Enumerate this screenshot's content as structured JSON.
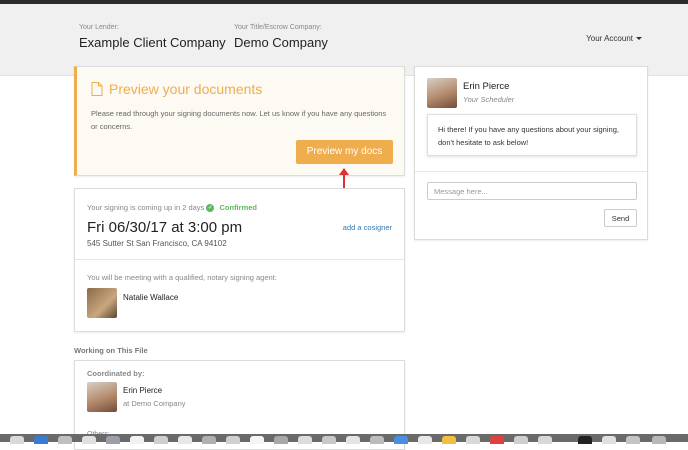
{
  "header": {
    "lender_label": "Your Lender:",
    "lender_value": "Example Client Company",
    "title_label": "Your Title/Escrow Company:",
    "title_value": "Demo Company",
    "account_label": "Your Account"
  },
  "preview": {
    "title": "Preview your documents",
    "text": "Please read through your signing documents now. Let us know if you have any questions or concerns.",
    "button_label": "Preview my docs",
    "accent_color": "#f0ad4e"
  },
  "signing": {
    "coming_text": "Your signing is coming up in 2 days",
    "status": "Confirmed",
    "date": "Fri 06/30/17 at 3:00 pm",
    "address": "545 Sutter St San Francisco, CA 94102",
    "cosigner_link": "add a cosigner",
    "meeting_text": "You will be meeting with a qualified, notary signing agent:",
    "agent_name": "Natalie Wallace"
  },
  "working": {
    "title": "Working on This File",
    "coordinated_label": "Coordinated by:",
    "coordinator_name": "Erin Pierce",
    "coordinator_company": "at Demo Company",
    "others_label": "Others:"
  },
  "scheduler": {
    "name": "Erin Pierce",
    "role": "Your Scheduler",
    "message": "Hi there! If you have any questions about your signing, don't hesitate to ask below!",
    "input_placeholder": "Message here...",
    "send_label": "Send"
  }
}
